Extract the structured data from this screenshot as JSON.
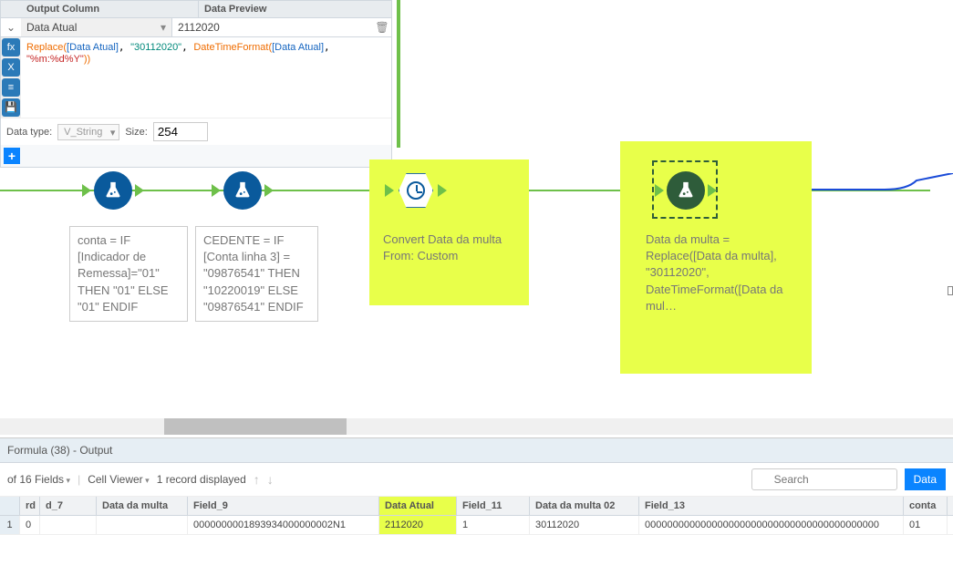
{
  "config": {
    "headers": {
      "output_col": "Output Column",
      "data_preview": "Data Preview"
    },
    "field_name": "Data Atual",
    "preview_value": "2112020",
    "formula_html": "<span class='fn-orange'>Replace(</span><span class='fn-blue'>[Data Atual]</span>, <span class='fn-teal'>\"30112020\"</span>, <span class='fn-orange'>DateTimeFormat(</span><span class='fn-blue'>[Data Atual]</span>, <span class='fn-red'>\"%m:%d%Y\"</span><span class='fn-orange'>))</span>",
    "datatype_label": "Data type:",
    "datatype_value": "V_String",
    "size_label": "Size:",
    "size_value": "254"
  },
  "nodes": {
    "n1": "conta = IF [Indicador de Remessa]=\"01\" THEN \"01\" ELSE \"01\" ENDIF",
    "n2": "CEDENTE = IF [Conta linha 3] = \"09876541\" THEN \"10220019\" ELSE \"09876541\" ENDIF",
    "n3": "Convert Data da multa From: Custom",
    "n4": "Data da multa = Replace([Data da multa], \"30112020\", DateTimeFormat([Data da mul…"
  },
  "results": {
    "title": "Formula (38) - Output",
    "fields_label": "of 16 Fields",
    "cell_viewer": "Cell Viewer",
    "records": "1 record displayed",
    "search_placeholder": "Search",
    "data_btn": "Data",
    "columns": [
      "rd",
      "d_7",
      "Data da multa",
      "Field_9",
      "Data Atual",
      "Field_11",
      "Data da multa 02",
      "Field_13",
      "conta"
    ],
    "row": {
      "num": "1",
      "rd": "0",
      "d_7": "",
      "data_da_multa": "",
      "field_9": "0000000001893934000000002N1",
      "data_atual": "2112020",
      "field_11": "1",
      "data_da_multa_02": "30112020",
      "field_13": "000000000000000000000000000000000000000000",
      "conta": "01"
    }
  }
}
